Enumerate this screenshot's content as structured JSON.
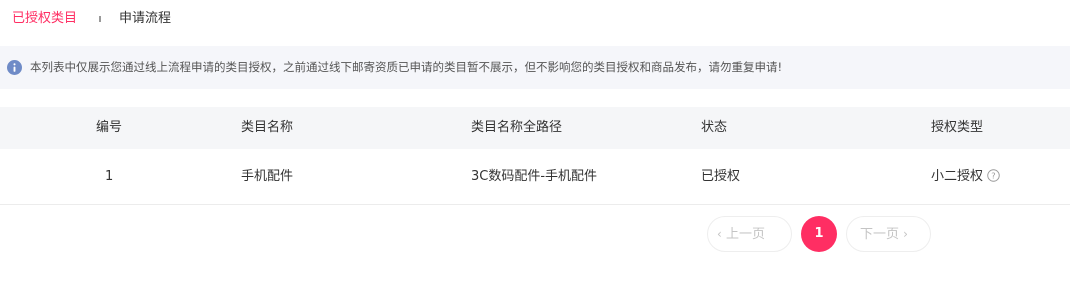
{
  "tabs": [
    {
      "label": "已授权类目",
      "active": true
    },
    {
      "label": "申请流程",
      "active": false
    }
  ],
  "notice": {
    "icon": "info-icon",
    "text": "本列表中仅展示您通过线上流程申请的类目授权，之前通过线下邮寄资质已申请的类目暂不展示，但不影响您的类目授权和商品发布，请勿重复申请!"
  },
  "table": {
    "columns": [
      "编号",
      "类目名称",
      "类目名称全路径",
      "状态",
      "授权类型"
    ],
    "rows": [
      {
        "no": "1",
        "name": "手机配件",
        "path": "3C数码配件-手机配件",
        "status": "已授权",
        "auth_type": "小二授权"
      }
    ]
  },
  "pagination": {
    "prev_label": "上一页",
    "next_label": "下一页",
    "current_page": "1"
  },
  "colors": {
    "accent": "#ff2e63",
    "notice_bg": "#f5f6fa",
    "info_icon": "#6f8bc7"
  }
}
